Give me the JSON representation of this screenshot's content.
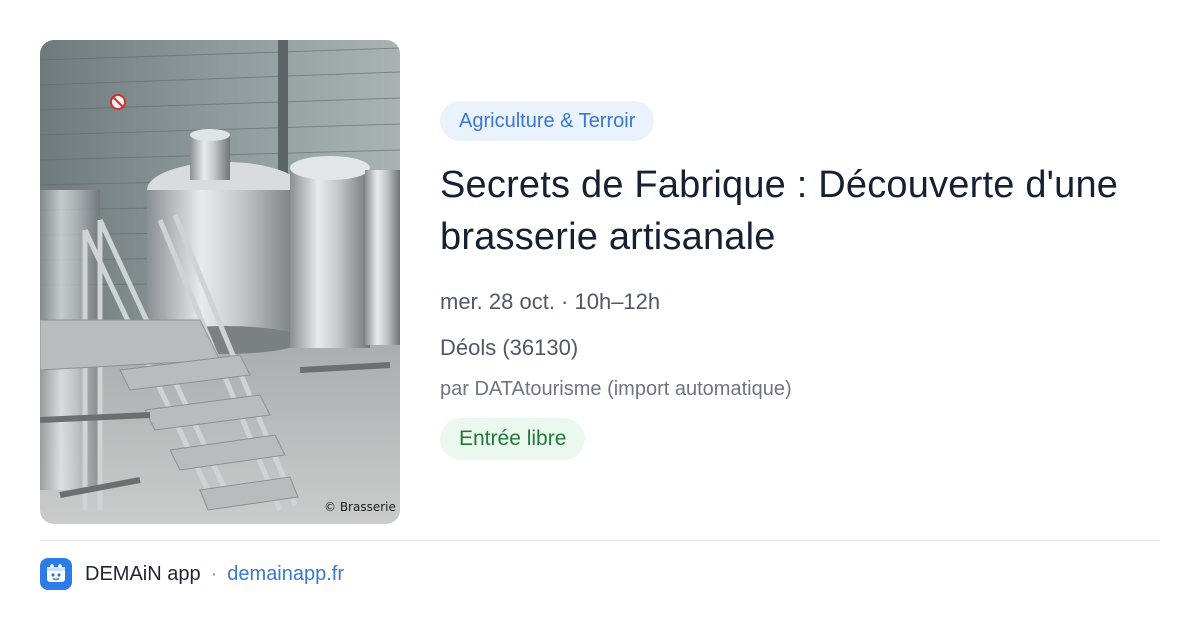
{
  "event": {
    "category": "Agriculture & Terroir",
    "title": "Secrets de Fabrique : Découverte d'une brasserie artisanale",
    "datetime": "mer. 28 oct. · 10h–12h",
    "location": "Déols (36130)",
    "organizer": "par DATAtourisme (import automatique)",
    "price_badge": "Entrée libre"
  },
  "photo": {
    "subject": "stainless steel brewing tanks with metal staircase",
    "credit": "© Brasserie"
  },
  "footer": {
    "app_icon": "demain-logo-icon",
    "app_name": "DEMAiN app",
    "separator": "·",
    "domain": "demainapp.fr"
  },
  "colors": {
    "accent_blue": "#3b77cf",
    "category_bg": "#eaf2fd",
    "free_green": "#217a3a",
    "free_bg": "#ebf8ee",
    "title": "#162033"
  }
}
